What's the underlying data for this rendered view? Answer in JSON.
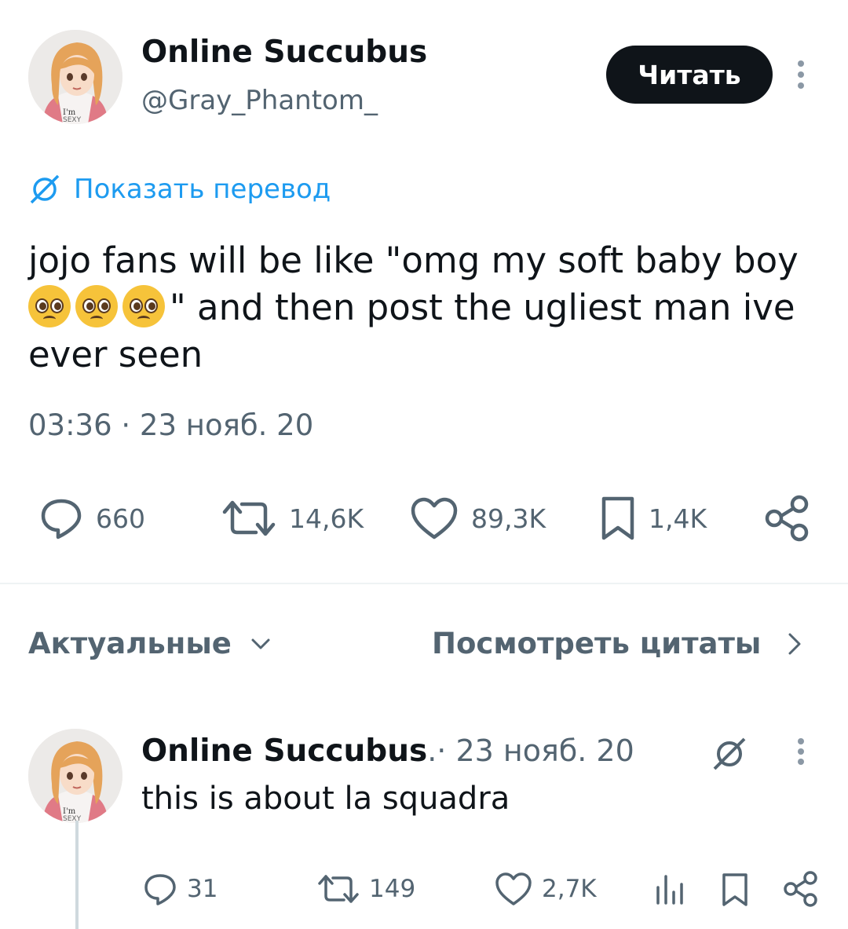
{
  "tweet": {
    "author": {
      "name": "Online Succubus",
      "handle": "@Gray_Phantom_",
      "avatar_badge": "I'm SEXY"
    },
    "follow_label": "Читать",
    "translate_label": "Показать перевод",
    "text_part1": "jojo fans will be like \"omg my soft baby boy ",
    "text_part2": "\" and then post the ugliest man ive ever seen",
    "emoji_name": "pleading-face",
    "timestamp": "03:36 · 23 нояб. 20",
    "stats": {
      "replies": "660",
      "retweets": "14,6K",
      "likes": "89,3K",
      "bookmarks": "1,4K"
    }
  },
  "sort_label": "Актуальные",
  "quotes_label": "Посмотреть цитаты",
  "reply": {
    "author_name": "Online Succubus",
    "author_suffix": " .",
    "date": " · 23 нояб. 20",
    "text": "this is about la squadra",
    "stats": {
      "replies": "31",
      "retweets": "149",
      "likes": "2,7K"
    }
  },
  "colors": {
    "text": "#0f1419",
    "secondary": "#536471",
    "link": "#1d9bf0",
    "button": "#0f1419",
    "divider": "#eff3f4"
  }
}
